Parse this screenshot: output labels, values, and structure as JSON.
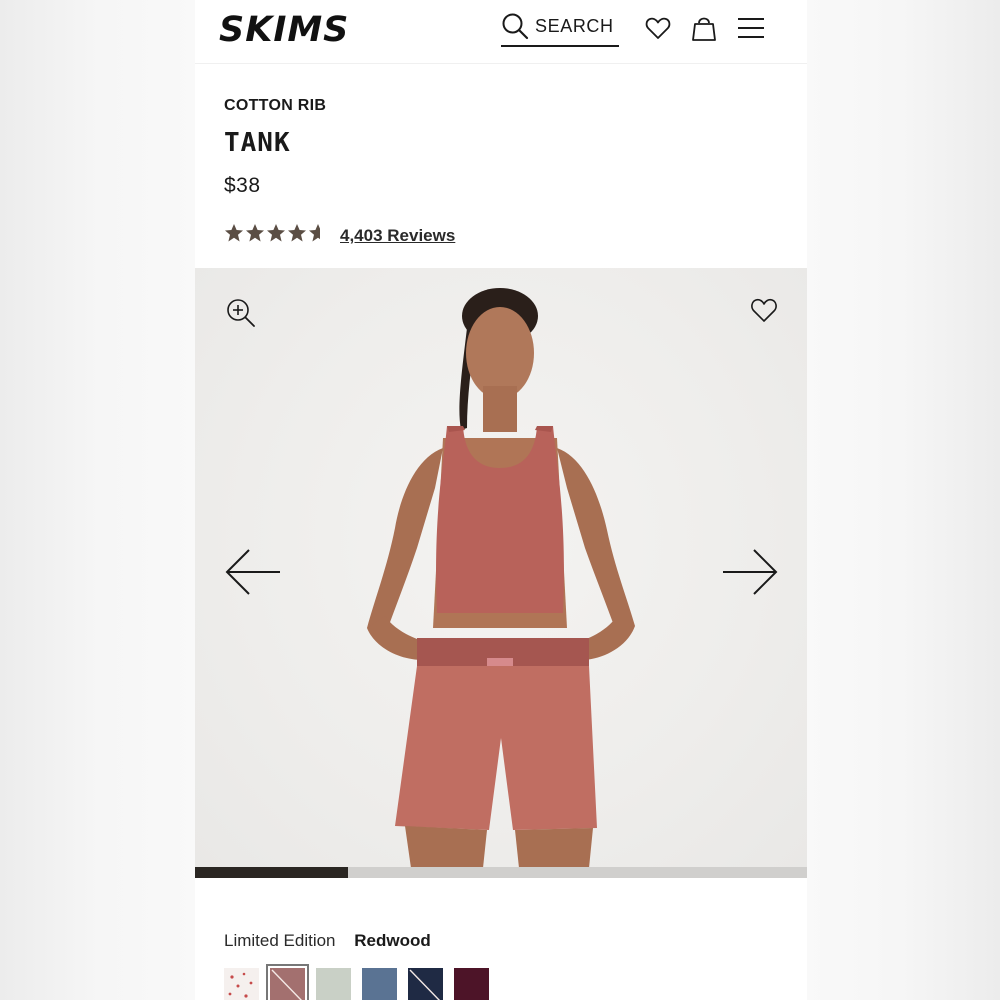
{
  "header": {
    "logo": "SKIMS",
    "search_label": "SEARCH"
  },
  "product": {
    "subtitle": "COTTON RIB",
    "title": "TANK",
    "price": "$38",
    "rating": 4.6,
    "reviews_label": "4,403 Reviews"
  },
  "gallery": {
    "image_description": "model wearing redwood ribbed tank and shorts",
    "progress": 0.25
  },
  "color": {
    "edition_label": "Limited Edition",
    "selected_name": "Redwood",
    "swatches": [
      {
        "name": "print",
        "hex": "#f5f0ee"
      },
      {
        "name": "redwood",
        "hex": "#a3706f",
        "selected": true
      },
      {
        "name": "sage",
        "hex": "#c9d0c6"
      },
      {
        "name": "slate-blue",
        "hex": "#5a7393"
      },
      {
        "name": "navy",
        "hex": "#1f2a44"
      },
      {
        "name": "burgundy",
        "hex": "#4d1428"
      }
    ]
  },
  "colors": {
    "text": "#1a1a1a",
    "star": "#5b4e44",
    "progress_fill": "#2a2622",
    "progress_track": "#d0cfcd",
    "garment": "#b8625a"
  }
}
